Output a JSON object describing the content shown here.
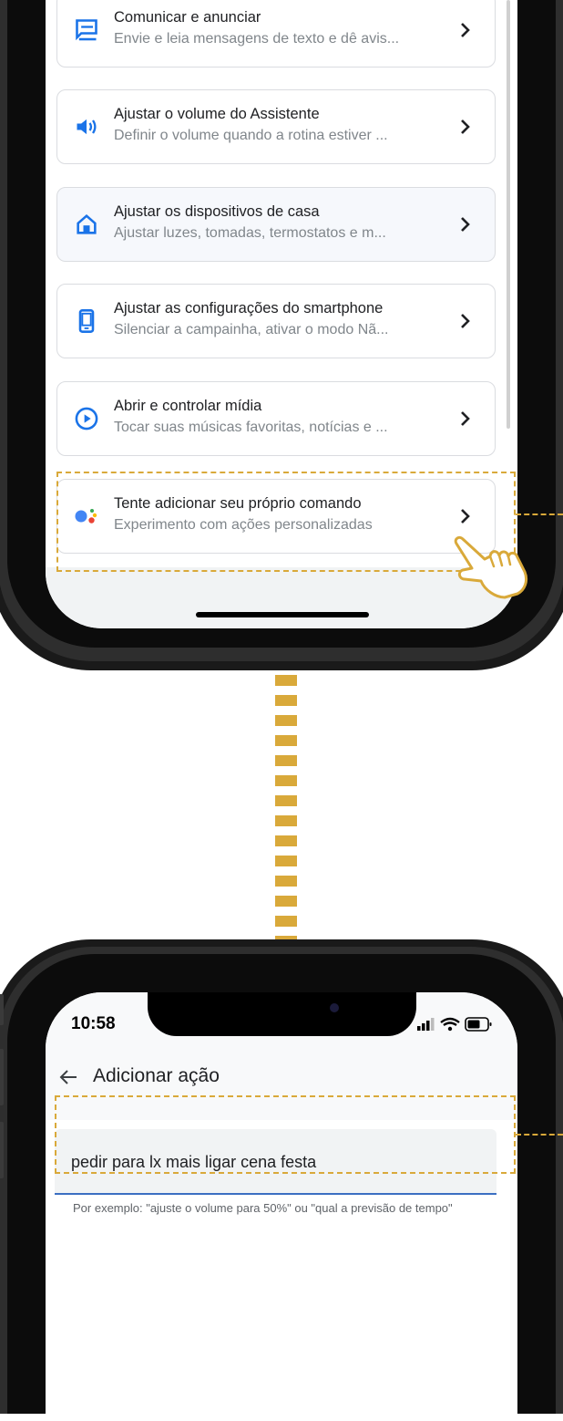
{
  "top_screen": {
    "cards": [
      {
        "icon": "message-icon",
        "title": "Comunicar e anunciar",
        "subtitle": "Envie e leia mensagens de texto e dê avis..."
      },
      {
        "icon": "volume-icon",
        "title": "Ajustar o volume do Assistente",
        "subtitle": "Definir o volume quando a rotina estiver ..."
      },
      {
        "icon": "home-icon",
        "title": "Ajustar os dispositivos de casa",
        "subtitle": "Ajustar luzes, tomadas, termostatos e m..."
      },
      {
        "icon": "smartphone-icon",
        "title": "Ajustar as configurações do smartphone",
        "subtitle": "Silenciar a campainha, ativar o modo Nã..."
      },
      {
        "icon": "play-icon",
        "title": "Abrir e controlar mídia",
        "subtitle": "Tocar suas músicas favoritas, notícias e ..."
      },
      {
        "icon": "assistant-icon",
        "title": "Tente adicionar seu próprio comando",
        "subtitle": "Experimento com ações personalizadas"
      }
    ]
  },
  "bottom_screen": {
    "time": "10:58",
    "title": "Adicionar ação",
    "input_value": "pedir para lx mais ligar cena festa",
    "helper_text": "Por exemplo: \"ajuste o volume para 50%\" ou \"qual a previsão de tempo\""
  },
  "colors": {
    "highlight": "#d9a93a",
    "icon_blue": "#1a73e8",
    "input_underline": "#3b6fc2"
  }
}
